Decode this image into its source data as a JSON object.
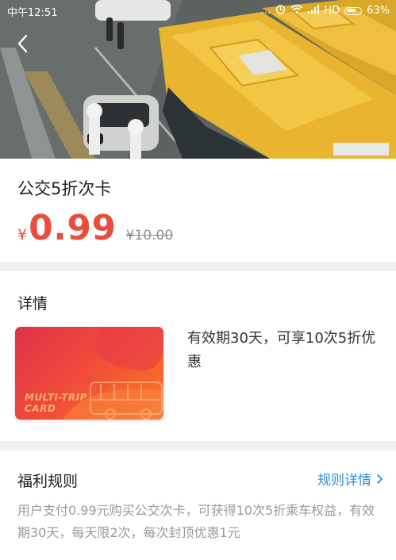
{
  "status_bar": {
    "time": "中午12:51",
    "dots": "...",
    "network": "HD",
    "battery": "63%"
  },
  "product": {
    "title": "公交5折次卡",
    "currency_symbol": "¥",
    "price": "0.99",
    "original_price": "¥10.00"
  },
  "details": {
    "heading": "详情",
    "card_text_line1": "MULTI-TRIP",
    "card_text_line2": "CARD",
    "description": "有效期30天，可享10次5折优惠"
  },
  "rules": {
    "heading": "福利规则",
    "link_label": "规则详情",
    "text": "用户支付0.99元购买公交次卡，可获得10次5折乘车权益，有效期30天，每天限2次，每次封顶优惠1元"
  },
  "colors": {
    "price": "#ea4d3d",
    "link": "#2f8fd6",
    "divider": "#f1f1f1"
  }
}
